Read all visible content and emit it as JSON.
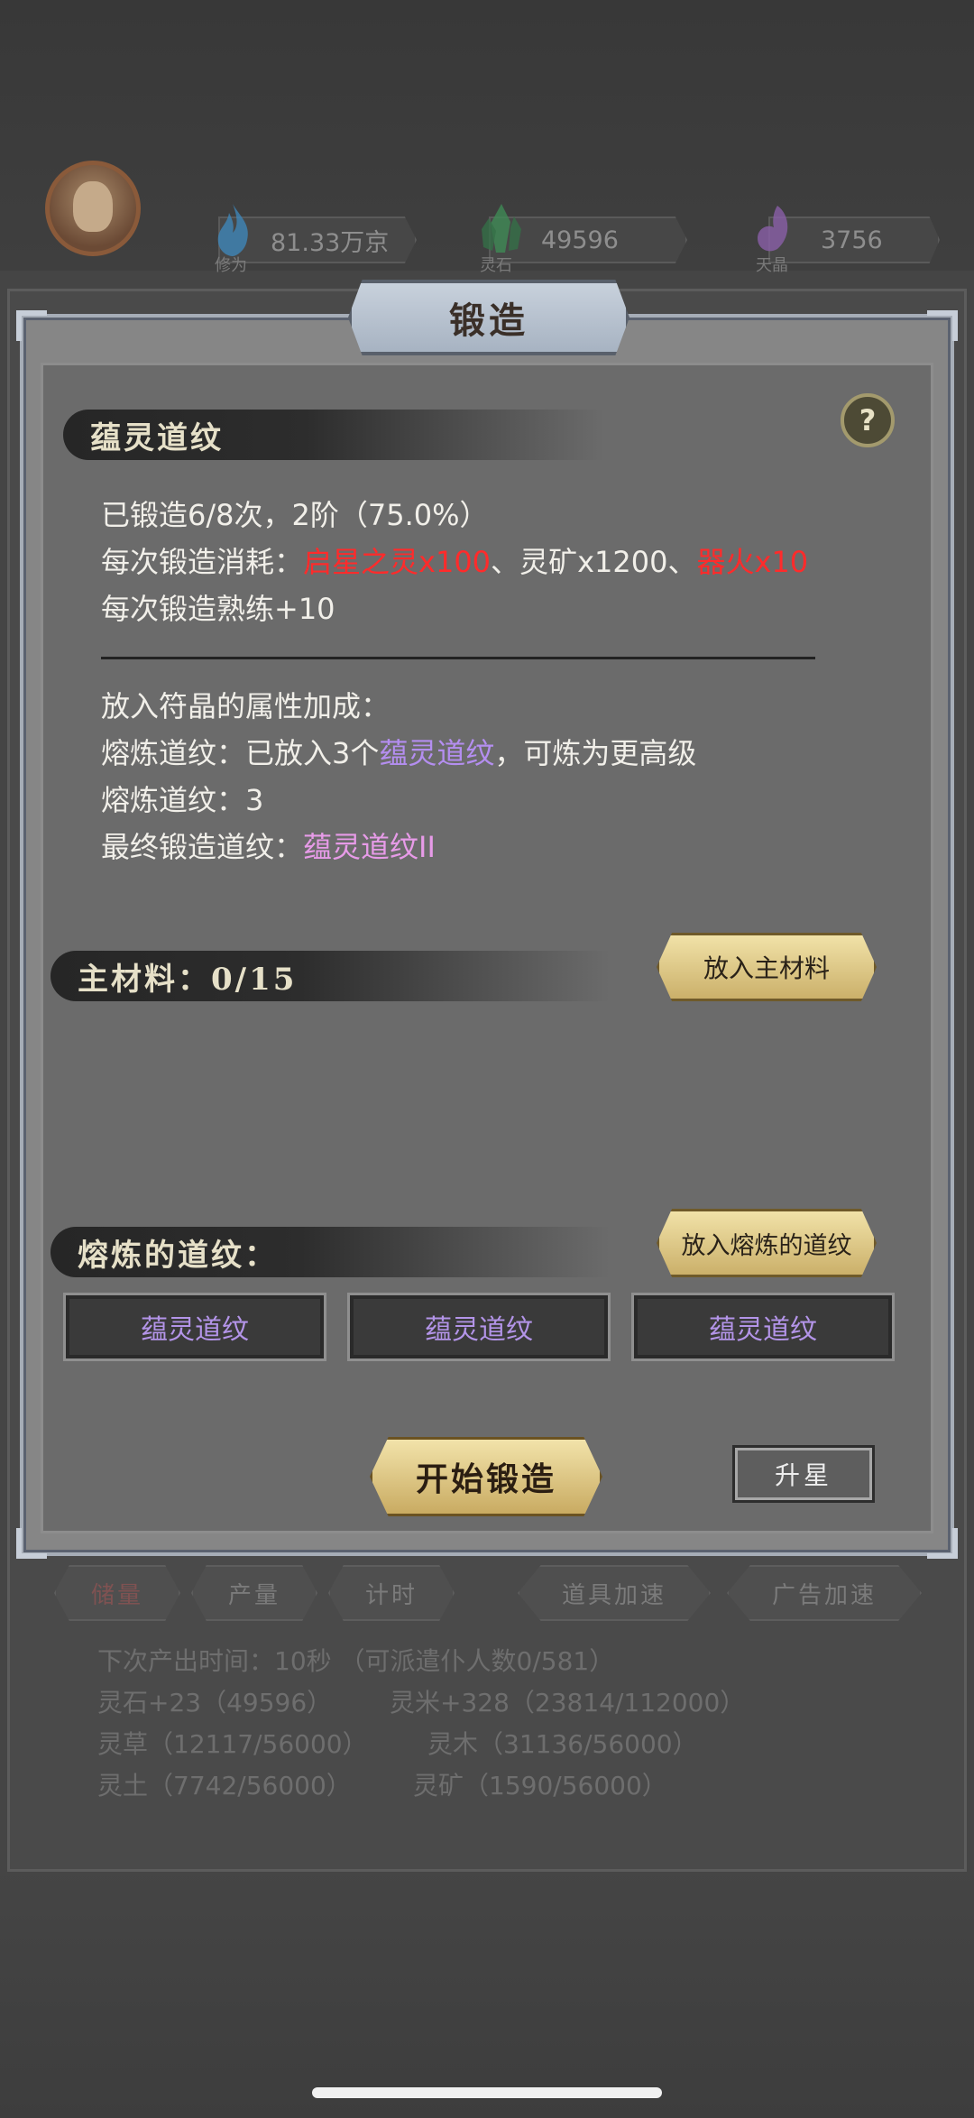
{
  "resources": [
    {
      "name": "修为",
      "value": "81.33万京",
      "color": "#3f86b8"
    },
    {
      "name": "灵石",
      "value": "49596",
      "color": "#3f8a55"
    },
    {
      "name": "天晶",
      "value": "3756",
      "color": "#8a5fa8"
    }
  ],
  "modal": {
    "title": "锻造",
    "help": "?",
    "item_name": "蕴灵道纹",
    "forge_progress": "已锻造6/8次，2阶（75.0%）",
    "cost_prefix": "每次锻造消耗：",
    "cost_item1": "启星之灵x100",
    "cost_sep1": "、",
    "cost_item2": "灵矿x1200",
    "cost_sep2": "、",
    "cost_item3": "器火x10",
    "proficiency": "每次锻造熟练+10",
    "bonus_title": "放入符晶的属性加成：",
    "smelt_prefix": "熔炼道纹：已放入3个",
    "smelt_item": "蕴灵道纹",
    "smelt_suffix": "，可炼为更高级",
    "smelt_count": "熔炼道纹：3",
    "final_prefix": "最终锻造道纹：",
    "final_item": "蕴灵道纹II",
    "main_material_label": "主材料：0/15",
    "main_material_button": "放入主材料",
    "smelt_section_label": "熔炼的道纹：",
    "smelt_button": "放入熔炼的道纹",
    "slots": [
      "蕴灵道纹",
      "蕴灵道纹",
      "蕴灵道纹"
    ],
    "start_button": "开始锻造",
    "star_button": "升星"
  },
  "background": {
    "tabs": [
      "储量",
      "产量",
      "计时",
      "道具加速",
      "广告加速"
    ],
    "next_output": "下次产出时间：10秒 （可派遣仆人数0/581）",
    "stats": [
      "灵石+23（49596）",
      "灵米+328（23814/112000）",
      "灵草（12117/56000）",
      "灵木（31136/56000）",
      "灵土（7742/56000）",
      "灵矿（1590/56000）"
    ]
  }
}
